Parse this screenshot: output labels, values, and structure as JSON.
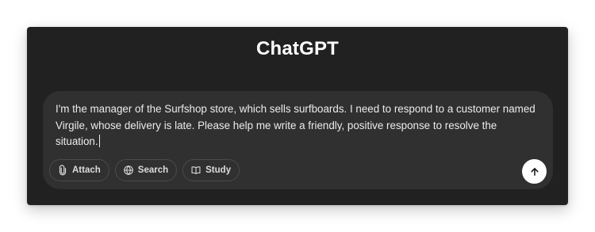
{
  "app": {
    "title": "ChatGPT"
  },
  "composer": {
    "text": "I'm the manager of the Surfshop store, which sells surfboards. I need to respond to a customer named Virgile, whose delivery is late. Please help me write a friendly, positive response to resolve the situation."
  },
  "toolbar": {
    "attach": {
      "label": "Attach",
      "icon": "paperclip-icon"
    },
    "search": {
      "label": "Search",
      "icon": "globe-icon"
    },
    "study": {
      "label": "Study",
      "icon": "book-icon"
    }
  },
  "send": {
    "icon": "arrow-up-icon"
  },
  "colors": {
    "window_bg": "#212121",
    "composer_bg": "#303030",
    "send_bg": "#ffffff"
  }
}
